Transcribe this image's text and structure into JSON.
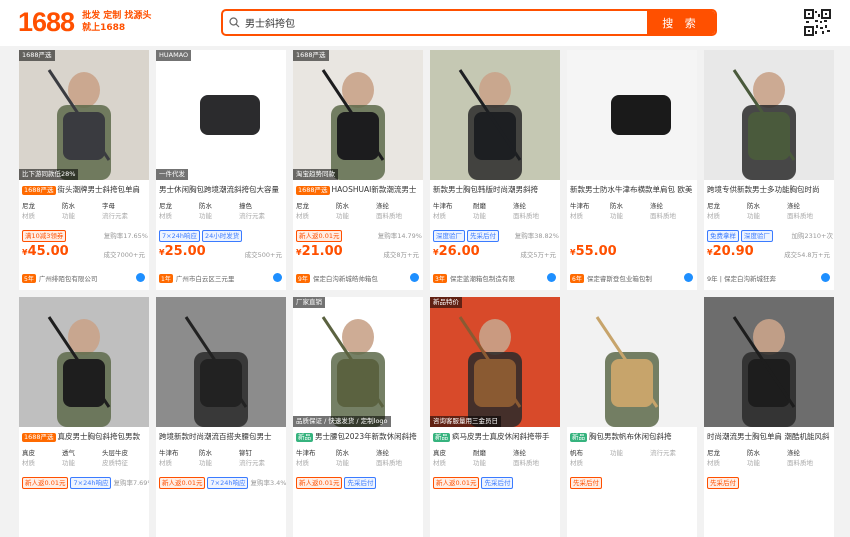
{
  "header": {
    "logo_num": "1688",
    "logo_slogan_line1": "批发 定制 找源头",
    "logo_slogan_line2": "就上1688",
    "search_value": "男士斜挎包",
    "search_button": "搜 索"
  },
  "colors": {
    "brand": "#ff5000",
    "tag_orange": "#ff6a00",
    "tag_green": "#36b37e",
    "blue": "#3b7bff"
  },
  "products": [
    {
      "badge": "1688严选",
      "title": "街头潮牌男士斜挎包单肩",
      "attrs": [
        [
          "尼龙",
          "材质"
        ],
        [
          "防水",
          "功能"
        ],
        [
          "字母",
          "流行元素"
        ]
      ],
      "promo": "满10减3领券",
      "rate": "复购率17.65%",
      "price": "45.00",
      "sales": "成交7000+元",
      "store": "广州绯陌包有限公司",
      "yr": "5年",
      "overlay_top": "1688严选",
      "overlay_bottom": "比下游同款低28%",
      "tag_color": "orange"
    },
    {
      "badge": "",
      "title": "男士休闲胸包跨境潮流斜挎包大容量",
      "attrs": [
        [
          "尼龙",
          "材质"
        ],
        [
          "防水",
          "功能"
        ],
        [
          "撞色",
          "流行元素"
        ]
      ],
      "promo": "7×24h响应",
      "promo2": "24小时发货",
      "rate": "",
      "price": "25.00",
      "sales": "成交500+元",
      "store": "广州市白云区三元里",
      "yr": "1年",
      "overlay_top": "HUAMAO",
      "overlay_bottom": "一件代发",
      "tag_color": ""
    },
    {
      "badge": "1688严选",
      "title": "HAOSHUAI新款潮流男士",
      "attrs": [
        [
          "尼龙",
          "材质"
        ],
        [
          "防水",
          "功能"
        ],
        [
          "涤纶",
          "面料质地"
        ]
      ],
      "promo": "新人返0.01元",
      "rate": "复购率14.79%",
      "price": "21.00",
      "sales": "成交8万+元",
      "store": "保定白沟新城皓帅箱包",
      "yr": "9年",
      "overlay_top": "1688严选",
      "overlay_bottom": "淘宝趋势同款",
      "tag_color": "orange"
    },
    {
      "badge": "",
      "title": "新款男士胸包韩版时尚潮男斜挎",
      "attrs": [
        [
          "牛津布",
          "材质"
        ],
        [
          "耐磨",
          "功能"
        ],
        [
          "涤纶",
          "面料质地"
        ]
      ],
      "promo": "深度验厂",
      "promo2": "先采后付",
      "rate": "复购率38.82%",
      "price": "26.00",
      "sales": "成交5万+元",
      "store": "保定蓝潮箱包制造有限",
      "yr": "3年",
      "overlay_top": "",
      "overlay_bottom": "",
      "tag_color": ""
    },
    {
      "badge": "",
      "title": "新款男士防水牛津布横款单肩包 欧美",
      "attrs": [
        [
          "牛津布",
          "材质"
        ],
        [
          "防水",
          "功能"
        ],
        [
          "涤纶",
          "面料质地"
        ]
      ],
      "promo": "",
      "rate": "",
      "price": "55.00",
      "sales": "",
      "store": "保定睿斯登包业箱包制",
      "yr": "6年",
      "overlay_top": "",
      "overlay_bottom": "",
      "tag_color": ""
    },
    {
      "badge": "",
      "title": "跨境专供新款男士多功能胸包时尚",
      "attrs": [
        [
          "尼龙",
          "材质"
        ],
        [
          "防水",
          "功能"
        ],
        [
          "涤纶",
          "面料质地"
        ]
      ],
      "promo": "免费拿样",
      "promo2": "深度验厂",
      "rate": "加购2310+次",
      "price": "20.90",
      "sales": "成交54.8万+元",
      "store": "9年 | 保定白沟新城狂奔",
      "yr": "",
      "overlay_top": "",
      "overlay_bottom": "",
      "tag_color": ""
    },
    {
      "badge": "1688严选",
      "title": "真皮男士胸包斜挎包男款",
      "attrs": [
        [
          "真皮",
          "材质"
        ],
        [
          "透气",
          "功能"
        ],
        [
          "头层牛皮",
          "皮质特征"
        ]
      ],
      "promo": "新人返0.01元",
      "promo2": "7×24h响应",
      "rate": "复购率7.69%",
      "price": "",
      "sales": "",
      "store": "",
      "yr": "",
      "overlay_top": "",
      "overlay_bottom": "",
      "tag_color": "orange"
    },
    {
      "badge": "",
      "title": "跨境新款时尚潮流百搭夹腰包男士",
      "attrs": [
        [
          "牛津布",
          "材质"
        ],
        [
          "防水",
          "功能"
        ],
        [
          "铆钉",
          "流行元素"
        ]
      ],
      "promo": "新人返0.01元",
      "promo2": "7×24h响应",
      "rate": "复购率3.4%",
      "price": "",
      "sales": "",
      "store": "",
      "yr": "",
      "overlay_top": "",
      "overlay_bottom": "",
      "tag_color": ""
    },
    {
      "badge": "新品",
      "title": "男士腰包2023年新款休闲斜挎",
      "attrs": [
        [
          "牛津布",
          "材质"
        ],
        [
          "防水",
          "功能"
        ],
        [
          "涤纶",
          "面料质地"
        ]
      ],
      "promo": "新人返0.01元",
      "promo2": "先采后付",
      "rate": "",
      "price": "",
      "sales": "",
      "store": "",
      "yr": "",
      "overlay_top": "厂家直销",
      "overlay_bottom": "品质保证 / 快速发货 / 定制logo",
      "tag_color": "green"
    },
    {
      "badge": "新品",
      "title": "疯马皮男士真皮休闲斜挎带手",
      "attrs": [
        [
          "真皮",
          "材质"
        ],
        [
          "耐磨",
          "功能"
        ],
        [
          "涤纶",
          "面料质地"
        ]
      ],
      "promo": "新人返0.01元",
      "promo2": "先采后付",
      "rate": "",
      "price": "",
      "sales": "",
      "store": "",
      "yr": "",
      "overlay_top": "新品特价",
      "overlay_bottom": "咨询客服量用三金员日",
      "tag_color": "green"
    },
    {
      "badge": "新品",
      "title": "胸包男款帆布休闲包斜挎",
      "attrs": [
        [
          "帆布",
          "材质"
        ],
        [
          "",
          "功能"
        ],
        [
          "",
          "流行元素"
        ]
      ],
      "promo": "先采后付",
      "rate": "",
      "price": "",
      "sales": "",
      "store": "",
      "yr": "",
      "overlay_top": "",
      "overlay_bottom": "",
      "tag_color": "green"
    },
    {
      "badge": "",
      "title": "时尚潮流男士胸包单肩 潮酷机能风斜",
      "attrs": [
        [
          "尼龙",
          "材质"
        ],
        [
          "防水",
          "功能"
        ],
        [
          "涤纶",
          "面料质地"
        ]
      ],
      "promo": "先采后付",
      "rate": "",
      "price": "",
      "sales": "",
      "store": "",
      "yr": "",
      "overlay_top": "",
      "overlay_bottom": "",
      "tag_color": ""
    }
  ]
}
